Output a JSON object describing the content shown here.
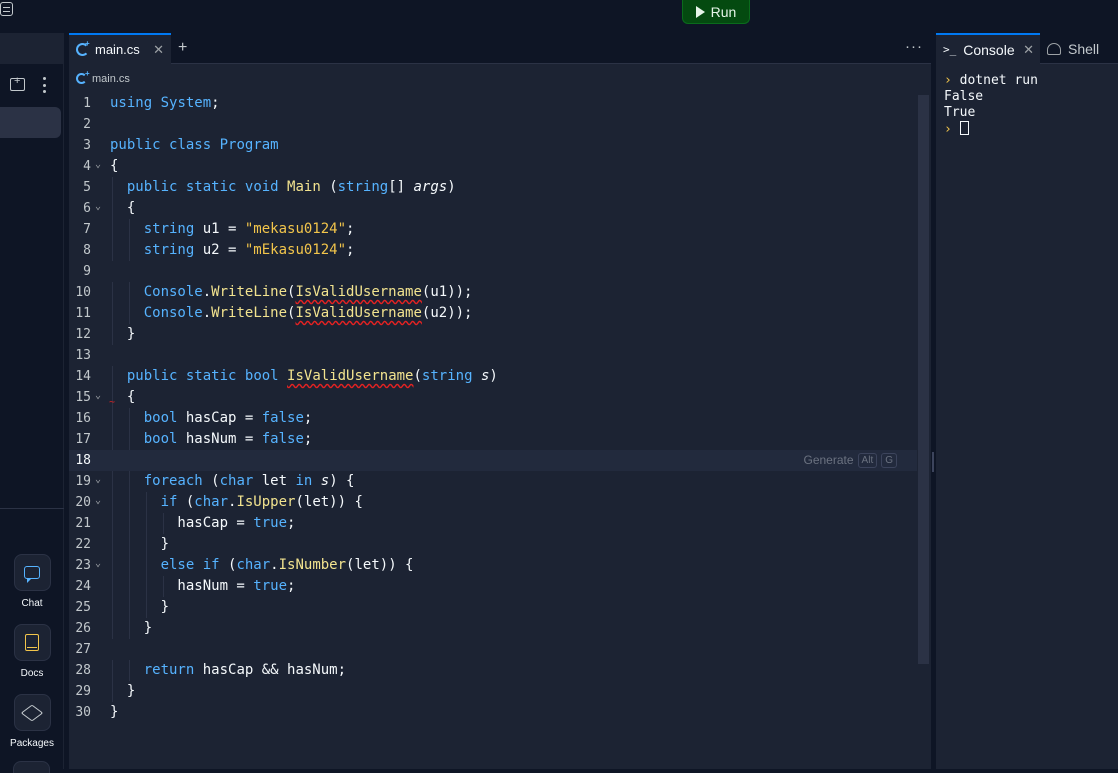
{
  "toolbar": {
    "run_label": "Run"
  },
  "sidebar": {
    "tools": [
      {
        "label": "Chat",
        "icon": "chat-icon"
      },
      {
        "label": "Docs",
        "icon": "docs-icon"
      },
      {
        "label": "Packages",
        "icon": "package-icon"
      }
    ]
  },
  "editor": {
    "tab_label": "main.cs",
    "breadcrumb": "main.cs",
    "generate_hint": {
      "label": "Generate",
      "keys": [
        "Alt",
        "G"
      ]
    },
    "lines": [
      "using System;",
      "",
      "public class Program",
      "{",
      "  public static void Main (string[] args)",
      "  {",
      "    string u1 = \"mekasu0124\";",
      "    string u2 = \"mEkasu0124\";",
      "",
      "    Console.WriteLine(IsValidUsername(u1));",
      "    Console.WriteLine(IsValidUsername(u2));",
      "  }",
      "",
      "  public static bool IsValidUsername(string s)",
      "  {",
      "    bool hasCap = false;",
      "    bool hasNum = false;",
      "",
      "    foreach (char let in s) {",
      "      if (char.IsUpper(let)) {",
      "        hasCap = true;",
      "      }",
      "      else if (char.IsNumber(let)) {",
      "        hasNum = true;",
      "      }",
      "    }",
      "",
      "    return hasCap && hasNum;",
      "  }",
      "}"
    ],
    "active_line": 18
  },
  "console_panel": {
    "tabs": [
      {
        "label": "Console",
        "icon": "terminal-prompt-icon"
      },
      {
        "label": "Shell",
        "icon": "shell-icon"
      }
    ],
    "output": [
      "dotnet run",
      "False",
      "True"
    ]
  },
  "colors": {
    "accent": "#0079f2",
    "run_button": "#044a10",
    "keyword": "#56b3ff",
    "function": "#f2e38f",
    "string": "#f2c54b",
    "error": "#e52222"
  }
}
